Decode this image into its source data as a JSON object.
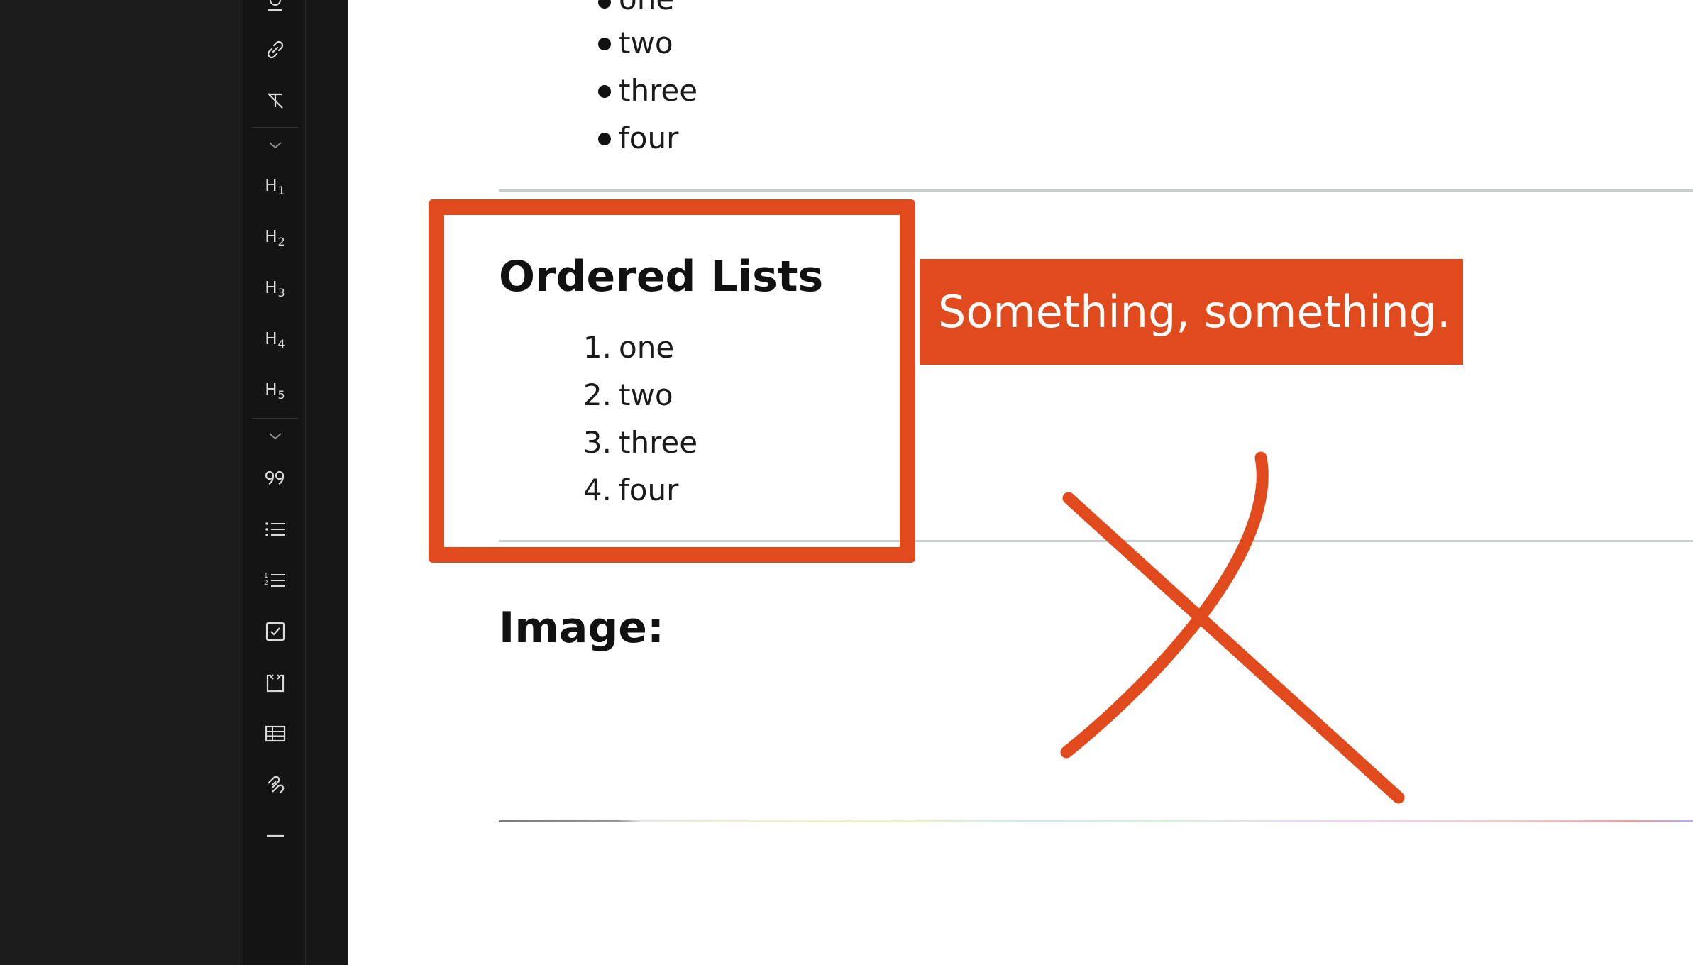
{
  "toolbar": {
    "items": [
      {
        "name": "mention-icon"
      },
      {
        "name": "link-icon"
      },
      {
        "name": "clear-format-icon"
      },
      {
        "name": "collapse-chevron-icon"
      },
      {
        "label": "H",
        "sub": "1"
      },
      {
        "label": "H",
        "sub": "2"
      },
      {
        "label": "H",
        "sub": "3"
      },
      {
        "label": "H",
        "sub": "4"
      },
      {
        "label": "H",
        "sub": "5"
      },
      {
        "name": "collapse-chevron-icon"
      },
      {
        "name": "blockquote-icon"
      },
      {
        "name": "bullet-list-icon"
      },
      {
        "name": "ordered-list-icon"
      },
      {
        "name": "task-list-icon"
      },
      {
        "name": "code-block-icon"
      },
      {
        "name": "table-icon"
      },
      {
        "name": "embed-link-icon"
      },
      {
        "name": "horizontal-rule-icon"
      }
    ]
  },
  "document": {
    "bullet_list": {
      "items": [
        "one",
        "two",
        "three",
        "four"
      ]
    },
    "ordered_list_section": {
      "heading": "Ordered Lists",
      "items": [
        {
          "num": "1.",
          "text": "one"
        },
        {
          "num": "2.",
          "text": "two"
        },
        {
          "num": "3.",
          "text": "three"
        },
        {
          "num": "4.",
          "text": "four"
        }
      ]
    },
    "image_section": {
      "heading": "Image:"
    }
  },
  "annotation": {
    "callout_text": "Something, something.",
    "color": "#e04a1c"
  }
}
